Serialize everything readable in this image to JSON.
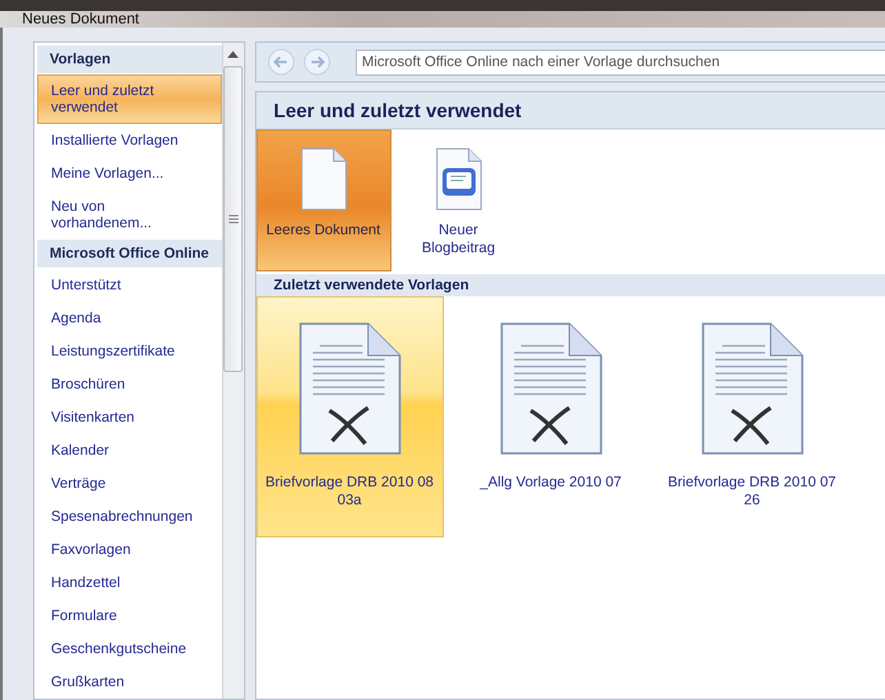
{
  "window": {
    "title": "Neues Dokument"
  },
  "sidebar": {
    "items": [
      {
        "kind": "header",
        "label": "Vorlagen",
        "selected": false
      },
      {
        "kind": "item",
        "label": "Leer und zuletzt verwendet",
        "selected": true
      },
      {
        "kind": "item",
        "label": "Installierte Vorlagen",
        "selected": false
      },
      {
        "kind": "item",
        "label": "Meine Vorlagen...",
        "selected": false
      },
      {
        "kind": "item",
        "label": "Neu von vorhandenem...",
        "selected": false
      },
      {
        "kind": "header",
        "label": "Microsoft Office Online",
        "selected": false
      },
      {
        "kind": "item",
        "label": "Unterstützt",
        "selected": false
      },
      {
        "kind": "item",
        "label": "Agenda",
        "selected": false
      },
      {
        "kind": "item",
        "label": "Leistungszertifikate",
        "selected": false
      },
      {
        "kind": "item",
        "label": "Broschüren",
        "selected": false
      },
      {
        "kind": "item",
        "label": "Visitenkarten",
        "selected": false
      },
      {
        "kind": "item",
        "label": "Kalender",
        "selected": false
      },
      {
        "kind": "item",
        "label": "Verträge",
        "selected": false
      },
      {
        "kind": "item",
        "label": "Spesenabrechnungen",
        "selected": false
      },
      {
        "kind": "item",
        "label": "Faxvorlagen",
        "selected": false
      },
      {
        "kind": "item",
        "label": "Handzettel",
        "selected": false
      },
      {
        "kind": "item",
        "label": "Formulare",
        "selected": false
      },
      {
        "kind": "item",
        "label": "Geschenkgutscheine",
        "selected": false
      },
      {
        "kind": "item",
        "label": "Grußkarten",
        "selected": false
      }
    ]
  },
  "search": {
    "placeholder": "Microsoft Office Online nach einer Vorlage durchsuchen"
  },
  "heading": "Leer und zuletzt verwendet",
  "blank_templates": [
    {
      "kind": "blank",
      "label": "Leeres Dokument",
      "selected": true
    },
    {
      "kind": "blog",
      "label": "Neuer Blogbeitrag",
      "selected": false
    }
  ],
  "recent_section": {
    "title": "Zuletzt verwendete Vorlagen",
    "templates": [
      {
        "kind": "template",
        "label": "Briefvorlage DRB 2010 08 03a",
        "selected": true
      },
      {
        "kind": "template",
        "label": "_Allg Vorlage 2010 07",
        "selected": false
      },
      {
        "kind": "template",
        "label": "Briefvorlage DRB 2010 07 26",
        "selected": false
      }
    ]
  }
}
